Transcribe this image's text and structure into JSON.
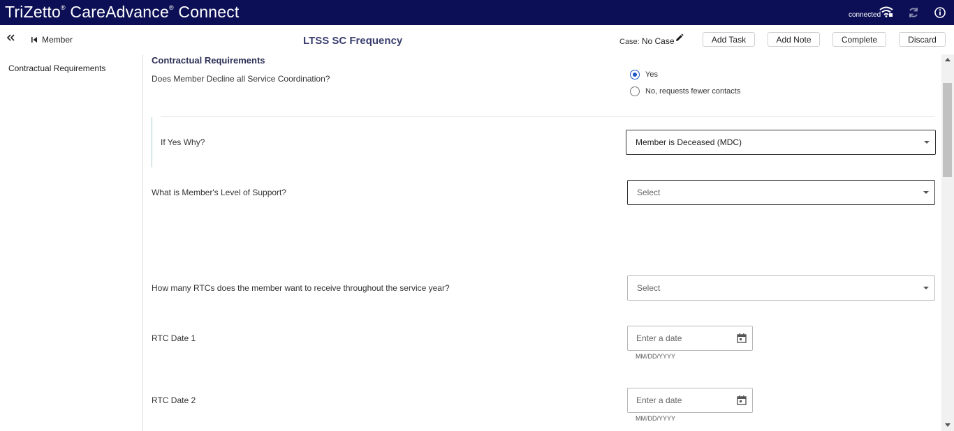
{
  "app": {
    "brand": "TriZetto",
    "brand_mark": "®",
    "product": "CareAdvance",
    "product_mark": "®",
    "product_suffix": "Connect",
    "status": "connected"
  },
  "header": {
    "back_label": "Member",
    "page_title": "LTSS SC Frequency",
    "case_label": "Case:",
    "case_value": "No Case",
    "buttons": {
      "add_task": "Add Task",
      "add_note": "Add Note",
      "complete": "Complete",
      "discard": "Discard"
    }
  },
  "sidebar": {
    "items": [
      {
        "label": "Contractual Requirements"
      }
    ]
  },
  "form": {
    "section_title": "Contractual Requirements",
    "q_decline": {
      "label": "Does Member Decline all Service Coordination?",
      "options": [
        {
          "label": "Yes",
          "selected": true
        },
        {
          "label": "No, requests fewer contacts",
          "selected": false
        }
      ]
    },
    "q_why": {
      "label": "If Yes Why?",
      "value": "Member is Deceased (MDC)"
    },
    "q_support": {
      "label": "What is Member's Level of Support?",
      "placeholder": "Select"
    },
    "q_rtcs": {
      "label": "How many RTCs does the member want to receive throughout the service year?",
      "placeholder": "Select"
    },
    "rtc_date_1": {
      "label": "RTC Date 1",
      "placeholder": "Enter a date",
      "hint": "MM/DD/YYYY"
    },
    "rtc_date_2": {
      "label": "RTC Date 2",
      "placeholder": "Enter a date",
      "hint": "MM/DD/YYYY"
    }
  },
  "colors": {
    "topbar": "#0c0f55",
    "title": "#3a3f6e",
    "radio_accent": "#1f56c4"
  }
}
